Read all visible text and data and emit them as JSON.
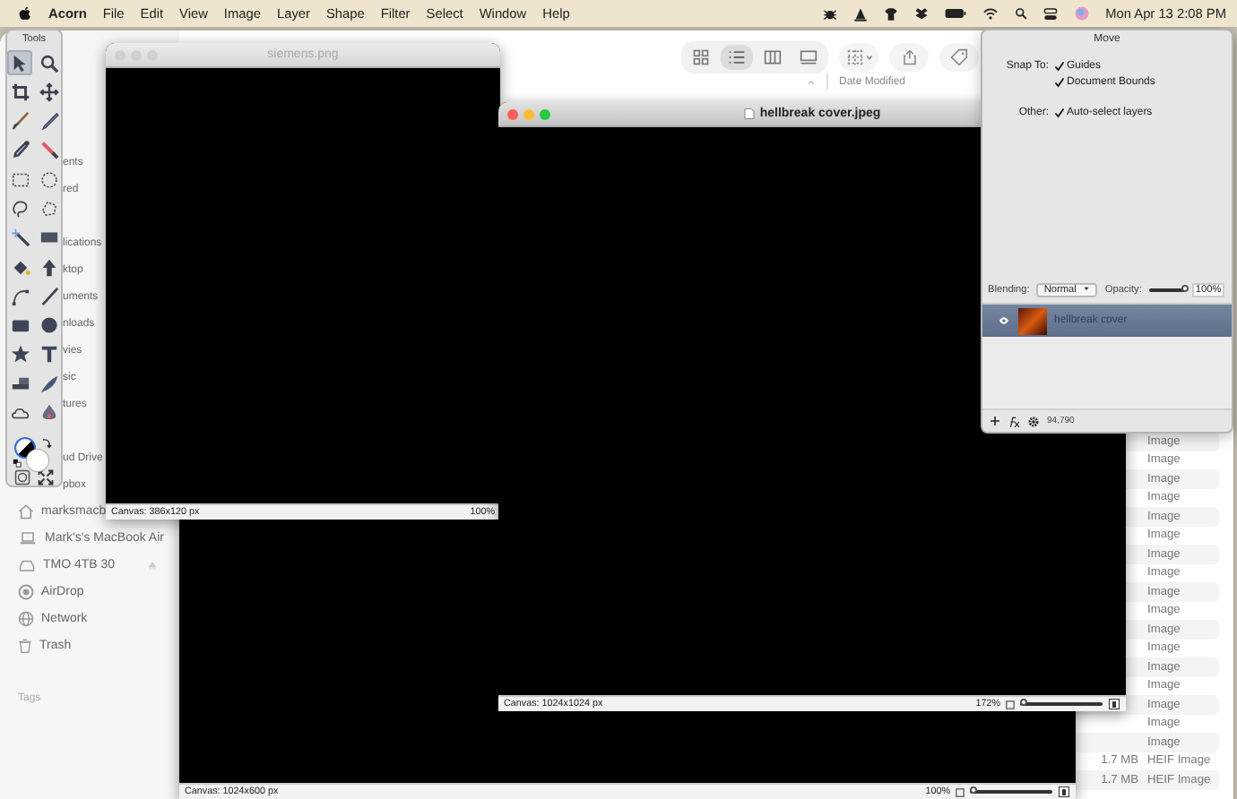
{
  "menu_bar": {
    "app": "Acorn",
    "menus": [
      "File",
      "Edit",
      "View",
      "Image",
      "Layer",
      "Shape",
      "Filter",
      "Select",
      "Window",
      "Help"
    ],
    "clock": "Mon Apr 13  2:08 PM"
  },
  "finder": {
    "view_modes": [
      {
        "selected": false
      },
      {
        "selected": true
      },
      {
        "selected": false
      },
      {
        "selected": false
      }
    ],
    "column_header": "Date Modified",
    "sidebar_groups": [
      [
        {
          "label": "ents",
          "kind": "fragment"
        },
        {
          "label": "red",
          "kind": "fragment"
        }
      ],
      [
        {
          "label": "lications",
          "kind": "fragment"
        },
        {
          "label": "ktop",
          "kind": "fragment"
        },
        {
          "label": "uments",
          "kind": "fragment"
        },
        {
          "label": "nloads",
          "kind": "fragment"
        },
        {
          "label": "vies",
          "kind": "fragment"
        },
        {
          "label": "sic",
          "kind": "fragment"
        },
        {
          "label": "tures",
          "kind": "fragment"
        }
      ],
      [
        {
          "label": "ud Drive",
          "kind": "fragment"
        },
        {
          "label": "pbox",
          "kind": "fragment"
        },
        {
          "label": "marksmacb",
          "kind": "home"
        },
        {
          "label": "Mark's's MacBook Air",
          "kind": "laptop"
        },
        {
          "label": "TMO 4TB 30",
          "kind": "drive"
        },
        {
          "label": "AirDrop",
          "kind": "airdrop"
        },
        {
          "label": "Network",
          "kind": "network"
        },
        {
          "label": "Trash",
          "kind": "trash"
        }
      ]
    ],
    "tags_heading": "Tags",
    "rows": [
      {
        "kind": "Image"
      },
      {
        "kind": "Image"
      },
      {
        "kind": "Image"
      },
      {
        "kind": "Image"
      },
      {
        "kind": "Image"
      },
      {
        "kind": "Image"
      },
      {
        "kind": "Image"
      },
      {
        "kind": "Image"
      },
      {
        "kind": "Image"
      },
      {
        "kind": "Image"
      },
      {
        "kind": "Image"
      },
      {
        "kind": "Image"
      },
      {
        "kind": "Image"
      },
      {
        "kind": "Image"
      },
      {
        "kind": "Image"
      },
      {
        "kind": "Image"
      },
      {
        "kind": "Image"
      },
      {
        "size": "1.7 MB",
        "kind": "HEIF Image"
      },
      {
        "size": "1.7 MB",
        "kind": "HEIF Image"
      }
    ]
  },
  "tools_palette": {
    "title": "Tools",
    "tools": [
      {
        "selected": true
      },
      {
        "selected": false
      },
      {
        "selected": false
      },
      {
        "selected": false
      },
      {
        "selected": false
      },
      {
        "selected": false
      },
      {
        "selected": false
      },
      {
        "selected": false
      },
      {
        "selected": false
      },
      {
        "selected": false
      },
      {
        "selected": false
      },
      {
        "selected": false
      },
      {
        "selected": false
      },
      {
        "selected": false
      },
      {
        "selected": false
      },
      {
        "selected": false
      },
      {
        "selected": false
      },
      {
        "selected": false
      },
      {
        "selected": false
      },
      {
        "selected": false
      },
      {
        "selected": false
      },
      {
        "selected": false
      },
      {
        "selected": false
      },
      {
        "selected": false
      },
      {
        "selected": false
      },
      {
        "selected": false
      }
    ]
  },
  "documents": [
    {
      "canvas": "Canvas: 1024x600 px",
      "zoom": "100%",
      "level": 0.05
    },
    {
      "title": "siemens.png",
      "canvas": "Canvas: 386x120 px",
      "zoom": "100%",
      "active": false
    },
    {
      "title": "hellbreak cover.jpeg",
      "canvas": "Canvas: 1024x1024 px",
      "zoom": "172%",
      "level": 0.05,
      "active": true
    }
  ],
  "move_panel": {
    "title": "Move",
    "snap_label": "Snap To:",
    "snap_options": [
      {
        "label": "Guides",
        "checked": true
      },
      {
        "label": "Document Bounds",
        "checked": true
      }
    ],
    "other_label": "Other:",
    "other_options": [
      {
        "label": "Auto-select layers",
        "checked": true
      }
    ],
    "blending_label": "Blending:",
    "blending": "Normal",
    "opacity_label": "Opacity:",
    "opacity": {
      "level": 1,
      "reading": "100%"
    },
    "layers": [
      {
        "name": "hellbreak cover",
        "visible": true,
        "selected": true
      }
    ],
    "footer_count": "94,790"
  }
}
